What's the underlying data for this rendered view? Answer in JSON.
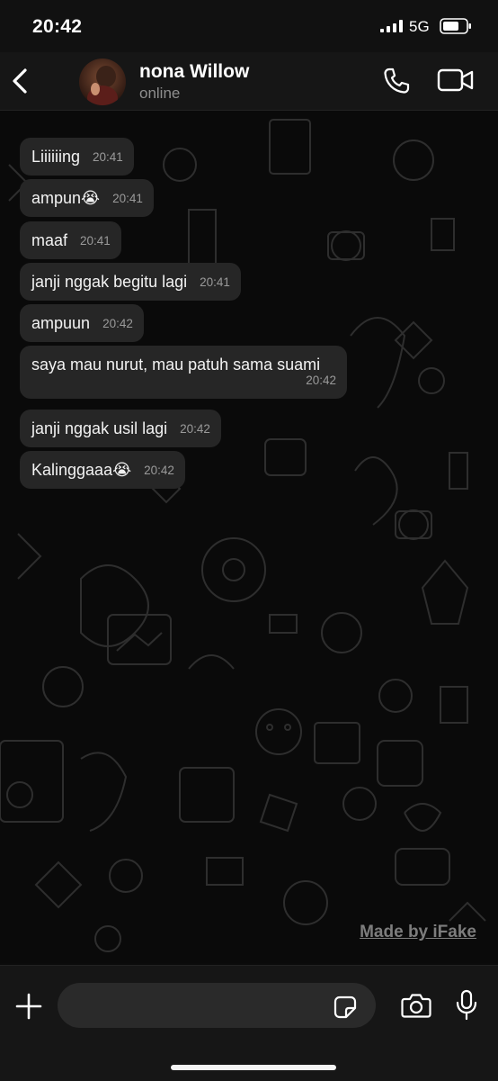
{
  "status_bar": {
    "time": "20:42",
    "network": "5G",
    "icons": [
      "signal-icon",
      "battery-icon"
    ]
  },
  "header": {
    "contact_name": "nona Willow",
    "contact_status": "online",
    "icons": [
      "back-chevron-icon",
      "phone-icon",
      "video-camera-icon"
    ]
  },
  "messages": [
    {
      "text": "Liiiiiing",
      "time": "20:41"
    },
    {
      "text": "ampun😭",
      "time": "20:41"
    },
    {
      "text": "maaf",
      "time": "20:41"
    },
    {
      "text": "janji nggak begitu lagi",
      "time": "20:41"
    },
    {
      "text": "ampuun",
      "time": "20:42"
    },
    {
      "text": "saya mau nurut, mau patuh sama suami",
      "time": "20:42"
    },
    {
      "text": "janji nggak usil lagi",
      "time": "20:42"
    },
    {
      "text": "Kalinggaaa😭",
      "time": "20:42"
    }
  ],
  "watermark": "Made by iFake",
  "input_bar": {
    "placeholder": "",
    "icons": [
      "plus-icon",
      "sticker-icon",
      "camera-icon",
      "microphone-icon"
    ]
  },
  "colors": {
    "background": "#0b0b0b",
    "bubble": "#262626",
    "header": "#161616",
    "secondary_text": "#8e8e8e"
  }
}
